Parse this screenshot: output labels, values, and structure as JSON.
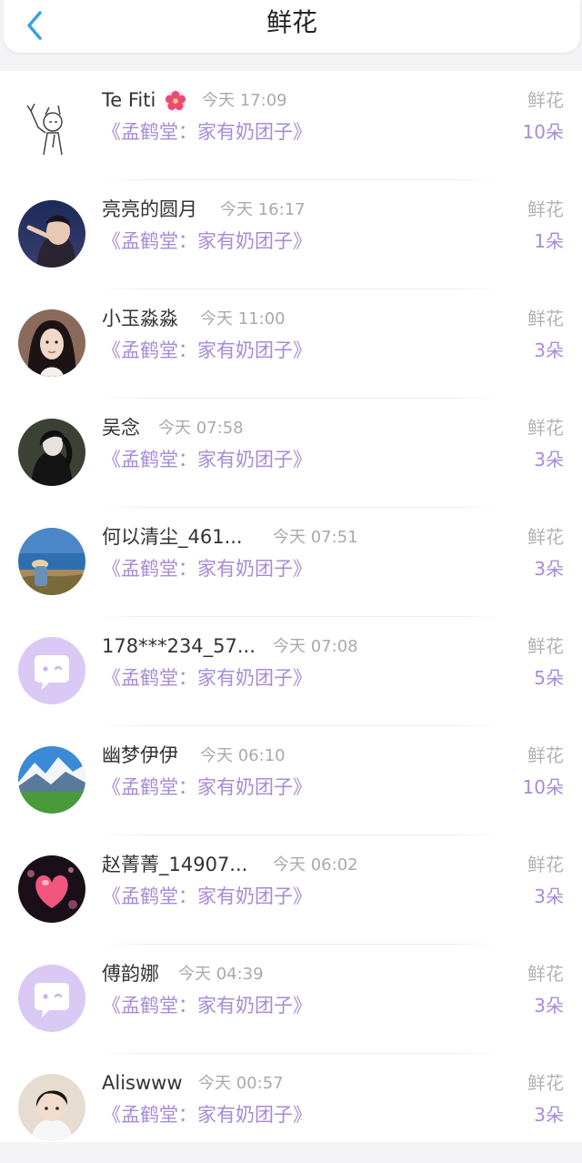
{
  "header": {
    "title": "鲜花",
    "back_icon": "chevron-left-icon",
    "accent": "#3aa0e8"
  },
  "colors": {
    "purple": "#a78bd6",
    "gray": "#b3b3b3"
  },
  "rows": [
    {
      "nick": "Te Fiti",
      "time": "今天 17:09",
      "book": "《孟鹤堂：家有奶团子》",
      "label": "鲜花",
      "count": "10朵",
      "avatar": "sketch",
      "badge": "flower-icon"
    },
    {
      "nick": "亮亮的圆月",
      "time": "今天 16:17",
      "book": "《孟鹤堂：家有奶团子》",
      "label": "鲜花",
      "count": "1朵",
      "avatar": "anime-dark"
    },
    {
      "nick": "小玉淼淼",
      "time": "今天 11:00",
      "book": "《孟鹤堂：家有奶团子》",
      "label": "鲜花",
      "count": "3朵",
      "avatar": "girl-photo"
    },
    {
      "nick": "吴念",
      "time": "今天 07:58",
      "book": "《孟鹤堂：家有奶团子》",
      "label": "鲜花",
      "count": "3朵",
      "avatar": "anime-black"
    },
    {
      "nick": "何以清尘_461...",
      "time": "今天 07:51",
      "book": "《孟鹤堂：家有奶团子》",
      "label": "鲜花",
      "count": "3朵",
      "avatar": "sea-photo"
    },
    {
      "nick": "178***234_57...",
      "time": "今天 07:08",
      "book": "《孟鹤堂：家有奶团子》",
      "label": "鲜花",
      "count": "5朵",
      "avatar": "default-chat"
    },
    {
      "nick": "幽梦伊伊",
      "time": "今天 06:10",
      "book": "《孟鹤堂：家有奶团子》",
      "label": "鲜花",
      "count": "10朵",
      "avatar": "mountain-photo"
    },
    {
      "nick": "赵菁菁_14907...",
      "time": "今天 06:02",
      "book": "《孟鹤堂：家有奶团子》",
      "label": "鲜花",
      "count": "3朵",
      "avatar": "heart-photo"
    },
    {
      "nick": "傅韵娜",
      "time": "今天 04:39",
      "book": "《孟鹤堂：家有奶团子》",
      "label": "鲜花",
      "count": "3朵",
      "avatar": "default-chat"
    },
    {
      "nick": "Aliswww",
      "time": "今天 00:57",
      "book": "《孟鹤堂：家有奶团子》",
      "label": "鲜花",
      "count": "3朵",
      "avatar": "boy-photo"
    }
  ]
}
